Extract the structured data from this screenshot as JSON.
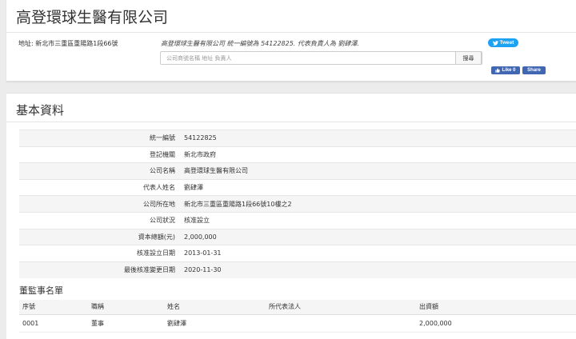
{
  "header": {
    "title": "高登環球生醫有限公司",
    "address": "地址: 新北市三重區重陽路1段66號",
    "summary": "高登環球生醫有限公司 統一編號為 54122825. 代表負責人為 劉肆澤.",
    "search": {
      "placeholder": "公司商號名稱 地址 負責人",
      "button_label": "搜尋"
    },
    "social": {
      "tweet_label": "Tweet",
      "like_label": "Like 0",
      "share_label": "Share"
    }
  },
  "basic": {
    "title": "基本資料",
    "rows": [
      {
        "label": "統一編號",
        "value": "54122825"
      },
      {
        "label": "登記機關",
        "value": "新北市政府"
      },
      {
        "label": "公司名稱",
        "value": "高登環球生醫有限公司"
      },
      {
        "label": "代表人姓名",
        "value": "劉肆澤"
      },
      {
        "label": "公司所在地",
        "value": "新北市三重區重陽路1段66號10樓之2"
      },
      {
        "label": "公司狀況",
        "value": "核准設立"
      },
      {
        "label": "資本總額(元)",
        "value": "2,000,000"
      },
      {
        "label": "核准設立日期",
        "value": "2013-01-31"
      },
      {
        "label": "最後核准變更日期",
        "value": "2020-11-30"
      }
    ]
  },
  "directors": {
    "title": "董監事名單",
    "columns": [
      "序號",
      "職稱",
      "姓名",
      "所代表法人",
      "出資額"
    ],
    "rows": [
      [
        "0001",
        "董事",
        "劉肆澤",
        "",
        "2,000,000"
      ]
    ]
  },
  "colors": {
    "tweet": "#1da1f2",
    "facebook": "#4267b2",
    "background": "#ececec"
  }
}
